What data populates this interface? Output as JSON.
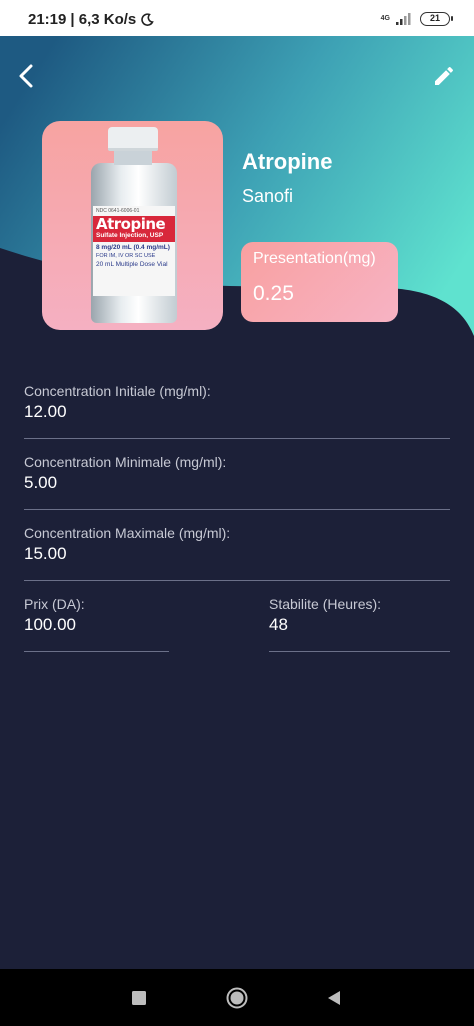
{
  "status_bar": {
    "time": "21:19",
    "network_speed": "| 6,3 Ko/s",
    "network_type": "4G",
    "battery": "21"
  },
  "colors": {
    "background": "#1c2038",
    "header_gradient_start": "#1e5a82",
    "header_gradient_end": "#5fe2cf",
    "card_pink": "#f8a0a0"
  },
  "header": {
    "back_icon": "chevron-left-icon",
    "edit_icon": "pencil-icon"
  },
  "medication": {
    "name": "Atropine",
    "laboratory": "Sanofi",
    "presentation_label": "Presentation(mg)",
    "presentation_value": "0.25",
    "vial_label": {
      "ndc": "NDC 0641-6006-01",
      "name": "Atropine",
      "subtitle": "Sulfate Injection, USP",
      "dose": "8 mg/20 mL (0.4 mg/mL)",
      "route": "FOR IM, IV OR SC USE",
      "multi": "20 mL Multiple Dose Vial"
    }
  },
  "fields": {
    "conc_initiale": {
      "label": "Concentration Initiale (mg/ml):",
      "value": "12.00"
    },
    "conc_minimale": {
      "label": "Concentration Minimale (mg/ml):",
      "value": "5.00"
    },
    "conc_maximale": {
      "label": "Concentration Maximale (mg/ml):",
      "value": "15.00"
    },
    "prix": {
      "label": "Prix (DA):",
      "value": "100.00"
    },
    "stabilite": {
      "label": "Stabilite (Heures):",
      "value": "48"
    }
  },
  "nav_bar": {
    "recents_icon": "square-icon",
    "home_icon": "circle-icon",
    "back_icon": "triangle-back-icon"
  }
}
